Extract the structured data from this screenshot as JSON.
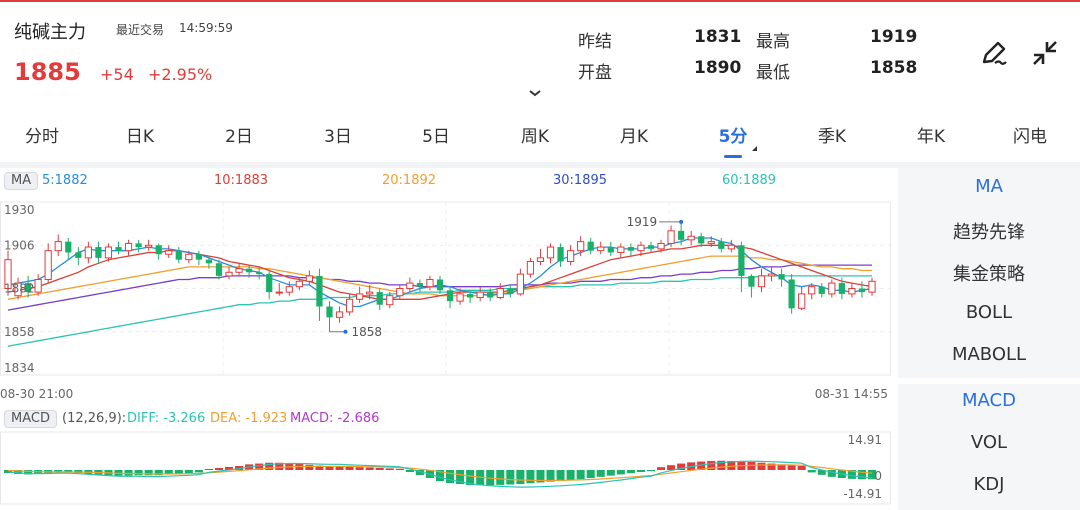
{
  "header": {
    "name": "纯碱主力",
    "recent_label": "最近交易",
    "time": "14:59:59",
    "price": "1885",
    "change": "+54",
    "change_pct": "+2.95%",
    "stats": {
      "prev_settle_label": "昨结",
      "prev_settle": "1831",
      "high_label": "最高",
      "high": "1919",
      "open_label": "开盘",
      "open": "1890",
      "low_label": "最低",
      "low": "1858"
    },
    "icons": [
      "pencil-icon",
      "collapse-icon"
    ]
  },
  "tabs": [
    "分时",
    "日K",
    "2日",
    "3日",
    "5日",
    "周K",
    "月K",
    "5分",
    "季K",
    "年K",
    "闪电"
  ],
  "active_tab": "5分",
  "ma_legend": {
    "tag": "MA",
    "ma5": "5:1882",
    "ma10": "10:1883",
    "ma20": "20:1892",
    "ma30": "30:1895",
    "ma60": "60:1889"
  },
  "colors": {
    "up": "#e33b3b",
    "down": "#19b06a",
    "ma5": "#2a8ddc",
    "ma10": "#d9403a",
    "ma20": "#f0a030",
    "ma30": "#7a3fc8",
    "ma60": "#2cc3b3",
    "dea": "#f0a030",
    "diff": "#2cc3b3"
  },
  "price_axis": {
    "labels": [
      "1930",
      "1906",
      "1882",
      "1858",
      "1834"
    ],
    "high_marker": "1919",
    "low_marker": "1858"
  },
  "time_axis": {
    "start": "08-30 21:00",
    "end": "08-31 14:55"
  },
  "macd_legend": {
    "tag": "MACD",
    "params": "(12,26,9):",
    "diff": "DIFF: -3.266",
    "dea": "DEA: -1.923",
    "macd": "MACD: -2.686"
  },
  "macd_axis": {
    "top": "14.91",
    "zero": "0",
    "bottom": "-14.91"
  },
  "right_panel": {
    "main_indicators": [
      "MA",
      "趋势先锋",
      "集金策略",
      "BOLL",
      "MABOLL"
    ],
    "sub_indicators": [
      "MACD",
      "VOL",
      "KDJ"
    ],
    "active_main": "MA",
    "active_sub": "MACD"
  },
  "chart_data": {
    "type": "candlestick",
    "interval": "5分",
    "ylim": [
      1834,
      1930
    ],
    "candles": [
      [
        1882,
        1898,
        1903,
        1878
      ],
      [
        1878,
        1885,
        1888,
        1876
      ],
      [
        1885,
        1880,
        1889,
        1877
      ],
      [
        1880,
        1887,
        1890,
        1878
      ],
      [
        1887,
        1903,
        1907,
        1885
      ],
      [
        1903,
        1908,
        1912,
        1900
      ],
      [
        1908,
        1902,
        1910,
        1898
      ],
      [
        1902,
        1899,
        1905,
        1895
      ],
      [
        1899,
        1905,
        1908,
        1896
      ],
      [
        1905,
        1899,
        1908,
        1896
      ],
      [
        1899,
        1905,
        1907,
        1897
      ],
      [
        1905,
        1903,
        1908,
        1901
      ],
      [
        1903,
        1907,
        1909,
        1900
      ],
      [
        1907,
        1905,
        1909,
        1902
      ],
      [
        1905,
        1906,
        1909,
        1903
      ],
      [
        1906,
        1901,
        1907,
        1898
      ],
      [
        1901,
        1903,
        1906,
        1899
      ],
      [
        1903,
        1898,
        1905,
        1896
      ],
      [
        1898,
        1901,
        1903,
        1896
      ],
      [
        1901,
        1898,
        1903,
        1895
      ],
      [
        1898,
        1896,
        1900,
        1893
      ],
      [
        1896,
        1889,
        1898,
        1887
      ],
      [
        1889,
        1891,
        1894,
        1887
      ],
      [
        1891,
        1893,
        1896,
        1889
      ],
      [
        1893,
        1891,
        1895,
        1888
      ],
      [
        1891,
        1890,
        1894,
        1887
      ],
      [
        1890,
        1880,
        1892,
        1876
      ],
      [
        1880,
        1880,
        1885,
        1878
      ],
      [
        1880,
        1883,
        1886,
        1878
      ],
      [
        1883,
        1886,
        1888,
        1881
      ],
      [
        1886,
        1889,
        1892,
        1884
      ],
      [
        1889,
        1872,
        1893,
        1864
      ],
      [
        1872,
        1866,
        1875,
        1858
      ],
      [
        1866,
        1869,
        1872,
        1863
      ],
      [
        1869,
        1876,
        1879,
        1867
      ],
      [
        1876,
        1879,
        1883,
        1874
      ],
      [
        1879,
        1880,
        1884,
        1876
      ],
      [
        1880,
        1873,
        1882,
        1870
      ],
      [
        1873,
        1878,
        1880,
        1871
      ],
      [
        1878,
        1882,
        1884,
        1876
      ],
      [
        1882,
        1885,
        1888,
        1880
      ],
      [
        1885,
        1883,
        1887,
        1880
      ],
      [
        1883,
        1887,
        1889,
        1881
      ],
      [
        1887,
        1881,
        1889,
        1879
      ],
      [
        1881,
        1875,
        1883,
        1871
      ],
      [
        1875,
        1879,
        1882,
        1873
      ],
      [
        1879,
        1877,
        1881,
        1874
      ],
      [
        1877,
        1880,
        1883,
        1875
      ],
      [
        1880,
        1877,
        1882,
        1875
      ],
      [
        1877,
        1882,
        1885,
        1876
      ],
      [
        1882,
        1879,
        1884,
        1877
      ],
      [
        1879,
        1890,
        1893,
        1878
      ],
      [
        1890,
        1897,
        1899,
        1888
      ],
      [
        1897,
        1899,
        1904,
        1895
      ],
      [
        1899,
        1905,
        1907,
        1896
      ],
      [
        1905,
        1897,
        1907,
        1894
      ],
      [
        1897,
        1903,
        1906,
        1895
      ],
      [
        1903,
        1908,
        1911,
        1900
      ],
      [
        1908,
        1903,
        1910,
        1901
      ],
      [
        1903,
        1905,
        1908,
        1901
      ],
      [
        1905,
        1902,
        1908,
        1900
      ],
      [
        1902,
        1905,
        1907,
        1899
      ],
      [
        1905,
        1903,
        1907,
        1900
      ],
      [
        1903,
        1906,
        1908,
        1900
      ],
      [
        1906,
        1904,
        1908,
        1902
      ],
      [
        1904,
        1907,
        1909,
        1902
      ],
      [
        1907,
        1914,
        1917,
        1905
      ],
      [
        1914,
        1909,
        1919,
        1906
      ],
      [
        1909,
        1911,
        1914,
        1906
      ],
      [
        1911,
        1907,
        1913,
        1905
      ],
      [
        1907,
        1908,
        1911,
        1905
      ],
      [
        1908,
        1904,
        1910,
        1902
      ],
      [
        1904,
        1906,
        1909,
        1902
      ],
      [
        1906,
        1889,
        1908,
        1880
      ],
      [
        1889,
        1883,
        1890,
        1877
      ],
      [
        1883,
        1889,
        1893,
        1880
      ],
      [
        1889,
        1890,
        1894,
        1886
      ],
      [
        1890,
        1887,
        1893,
        1883
      ],
      [
        1887,
        1871,
        1890,
        1868
      ],
      [
        1871,
        1879,
        1883,
        1870
      ],
      [
        1879,
        1883,
        1885,
        1876
      ],
      [
        1883,
        1879,
        1885,
        1877
      ],
      [
        1879,
        1885,
        1887,
        1877
      ],
      [
        1885,
        1879,
        1888,
        1876
      ],
      [
        1879,
        1882,
        1885,
        1877
      ],
      [
        1882,
        1880,
        1886,
        1877
      ],
      [
        1880,
        1886,
        1888,
        1878
      ]
    ],
    "macd_hist": [
      -1.5,
      -2.0,
      -2.2,
      -2.0,
      -1.6,
      -1.2,
      -1.2,
      -1.6,
      -2.0,
      -2.4,
      -2.6,
      -2.8,
      -2.8,
      -2.6,
      -2.6,
      -2.6,
      -2.2,
      -1.8,
      -1.6,
      -1.2,
      0.5,
      1.0,
      1.5,
      2.0,
      2.8,
      3.2,
      3.6,
      3.6,
      3.4,
      3.0,
      2.6,
      2.2,
      2.0,
      2.0,
      1.6,
      1.4,
      1.2,
      1.0,
      0.8,
      0.6,
      -1.0,
      -2.5,
      -4.0,
      -5.5,
      -6.5,
      -7.0,
      -7.5,
      -7.6,
      -7.6,
      -7.4,
      -7.2,
      -7.0,
      -6.6,
      -6.2,
      -5.8,
      -5.4,
      -5.0,
      -4.6,
      -4.0,
      -3.4,
      -2.8,
      -2.2,
      -1.6,
      -1.0,
      -0.6,
      1.4,
      2.4,
      3.2,
      3.8,
      4.2,
      4.5,
      4.6,
      4.5,
      4.3,
      4.0,
      3.6,
      3.2,
      2.8,
      2.4,
      2.0,
      -1.2,
      -2.4,
      -3.4,
      -4.0,
      -4.4,
      -4.6,
      -4.6
    ],
    "ma5": [
      1884,
      1885,
      1886,
      1887,
      1890,
      1894,
      1898,
      1902,
      1904,
      1903,
      1903,
      1903,
      1903,
      1904,
      1905,
      1904,
      1904,
      1903,
      1902,
      1901,
      1899,
      1897,
      1895,
      1893,
      1892,
      1891,
      1888,
      1886,
      1884,
      1884,
      1884,
      1880,
      1877,
      1874,
      1872,
      1872,
      1874,
      1876,
      1876,
      1878,
      1880,
      1882,
      1883,
      1884,
      1883,
      1881,
      1880,
      1879,
      1878,
      1879,
      1879,
      1882,
      1885,
      1889,
      1894,
      1898,
      1900,
      1902,
      1904,
      1905,
      1905,
      1904,
      1904,
      1904,
      1905,
      1905,
      1907,
      1908,
      1910,
      1910,
      1910,
      1908,
      1907,
      1903,
      1898,
      1894,
      1891,
      1888,
      1884,
      1883,
      1884,
      1883,
      1881,
      1881,
      1880,
      1881,
      1882
    ],
    "ma10": [
      1880,
      1881,
      1882,
      1883,
      1885,
      1887,
      1889,
      1891,
      1894,
      1896,
      1898,
      1899,
      1900,
      1901,
      1902,
      1902,
      1903,
      1903,
      1902,
      1901,
      1900,
      1899,
      1897,
      1896,
      1895,
      1894,
      1892,
      1890,
      1888,
      1887,
      1886,
      1884,
      1882,
      1880,
      1879,
      1878,
      1877,
      1876,
      1876,
      1876,
      1876,
      1876,
      1877,
      1878,
      1879,
      1880,
      1880,
      1880,
      1880,
      1880,
      1881,
      1882,
      1883,
      1884,
      1886,
      1888,
      1890,
      1892,
      1894,
      1896,
      1898,
      1899,
      1900,
      1901,
      1902,
      1903,
      1904,
      1904,
      1905,
      1906,
      1906,
      1906,
      1906,
      1905,
      1904,
      1902,
      1900,
      1898,
      1896,
      1894,
      1892,
      1890,
      1888,
      1886,
      1885,
      1884,
      1883
    ],
    "ma20": [
      1876,
      1877,
      1878,
      1879,
      1880,
      1881,
      1882,
      1883,
      1884,
      1885,
      1886,
      1887,
      1888,
      1889,
      1890,
      1891,
      1892,
      1893,
      1894,
      1894,
      1894,
      1894,
      1894,
      1894,
      1894,
      1893,
      1893,
      1892,
      1891,
      1890,
      1889,
      1888,
      1887,
      1886,
      1885,
      1884,
      1883,
      1882,
      1881,
      1880,
      1879,
      1879,
      1879,
      1878,
      1878,
      1878,
      1878,
      1878,
      1879,
      1879,
      1880,
      1881,
      1882,
      1883,
      1884,
      1885,
      1886,
      1887,
      1888,
      1889,
      1890,
      1891,
      1892,
      1893,
      1894,
      1895,
      1896,
      1897,
      1898,
      1899,
      1900,
      1900,
      1900,
      1900,
      1899,
      1899,
      1898,
      1898,
      1897,
      1896,
      1895,
      1894,
      1894,
      1893,
      1893,
      1892,
      1892
    ],
    "ma30": [
      1870,
      1871,
      1872,
      1873,
      1874,
      1875,
      1876,
      1877,
      1878,
      1879,
      1880,
      1881,
      1882,
      1883,
      1884,
      1885,
      1886,
      1887,
      1887,
      1888,
      1888,
      1888,
      1889,
      1889,
      1889,
      1889,
      1889,
      1889,
      1889,
      1888,
      1888,
      1888,
      1887,
      1887,
      1886,
      1886,
      1885,
      1885,
      1884,
      1884,
      1884,
      1883,
      1883,
      1883,
      1883,
      1883,
      1883,
      1883,
      1883,
      1883,
      1884,
      1884,
      1884,
      1884,
      1885,
      1885,
      1885,
      1886,
      1886,
      1886,
      1887,
      1887,
      1887,
      1888,
      1888,
      1889,
      1889,
      1890,
      1890,
      1891,
      1891,
      1892,
      1892,
      1893,
      1893,
      1894,
      1894,
      1894,
      1895,
      1895,
      1895,
      1895,
      1895,
      1895,
      1895,
      1895,
      1895
    ],
    "ma60": [
      1850,
      1851,
      1852,
      1853,
      1854,
      1855,
      1856,
      1857,
      1858,
      1859,
      1860,
      1861,
      1862,
      1863,
      1864,
      1865,
      1866,
      1867,
      1868,
      1869,
      1870,
      1871,
      1872,
      1873,
      1873,
      1874,
      1874,
      1875,
      1875,
      1876,
      1876,
      1876,
      1877,
      1877,
      1877,
      1878,
      1878,
      1878,
      1879,
      1879,
      1879,
      1880,
      1880,
      1880,
      1880,
      1881,
      1881,
      1881,
      1881,
      1882,
      1882,
      1882,
      1882,
      1883,
      1883,
      1883,
      1883,
      1884,
      1884,
      1884,
      1884,
      1885,
      1885,
      1885,
      1885,
      1886,
      1886,
      1886,
      1887,
      1887,
      1887,
      1888,
      1888,
      1888,
      1888,
      1889,
      1889,
      1889,
      1889,
      1889,
      1889,
      1889,
      1889,
      1889,
      1889,
      1889,
      1889
    ]
  }
}
